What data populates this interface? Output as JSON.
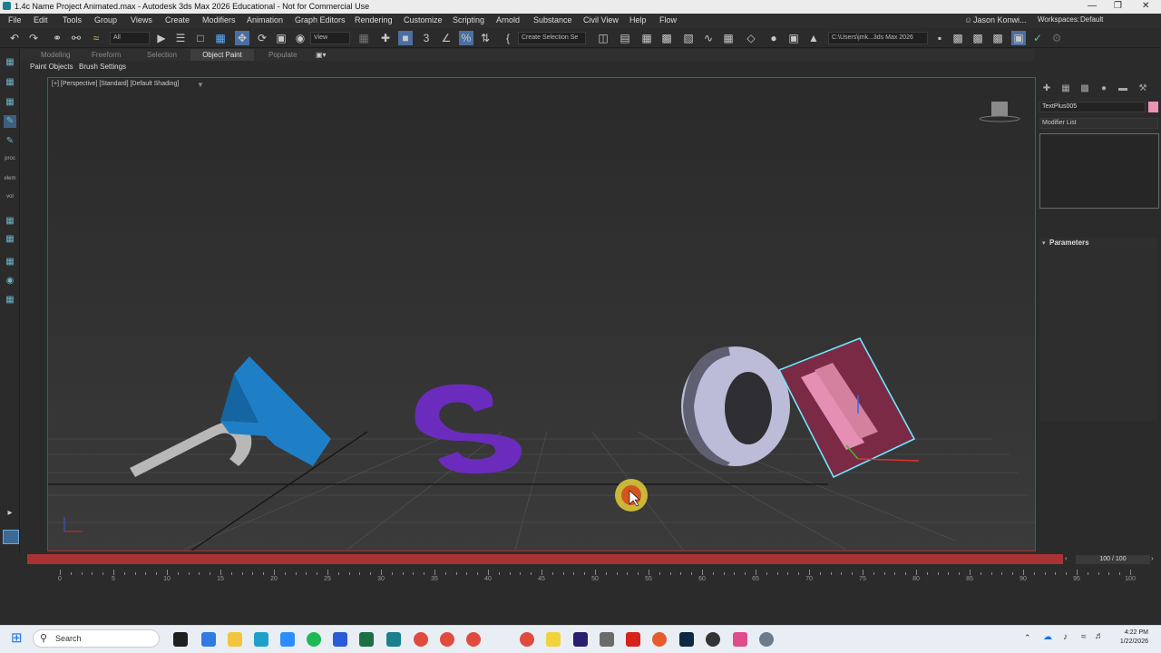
{
  "window": {
    "title": "1.4c Name Project Animated.max - Autodesk 3ds Max 2026 Educational - Not for Commercial Use",
    "minimize": "—",
    "maximize": "❐",
    "close": "✕"
  },
  "menu": [
    "File",
    "Edit",
    "Tools",
    "Group",
    "Views",
    "Create",
    "Modifiers",
    "Animation",
    "Graph Editors",
    "Rendering",
    "Customize",
    "Scripting",
    "Arnold",
    "Substance",
    "Civil View",
    "Help",
    "Flow"
  ],
  "user": {
    "name": "Jason Konwi...",
    "workspaces_label": "Workspaces:",
    "workspace": "Default"
  },
  "toolbar": {
    "filter": "All",
    "refcoord": "View",
    "selection_set": "Create Selection Se",
    "path": "C:\\Users\\jmk...3ds Max 2026"
  },
  "ribbon": {
    "tabs": [
      "Modeling",
      "Freeform",
      "Selection",
      "Object Paint",
      "Populate"
    ],
    "active": "Object Paint",
    "subtabs": [
      "Paint Objects",
      "Brush Settings"
    ]
  },
  "left_tools": [
    "proc",
    "elem",
    "vol"
  ],
  "viewport": {
    "label": "[+] [Perspective] [Standard] [Default Shading]"
  },
  "command_panel": {
    "object_name": "TextPlus005",
    "modifier_list": "Modifier List",
    "rollout": "Parameters",
    "object_color": "#e993b6"
  },
  "timeline": {
    "frame_readout": "100 / 100",
    "ticks": [
      "0",
      "5",
      "10",
      "15",
      "20",
      "25",
      "30",
      "35",
      "40",
      "45",
      "50",
      "55",
      "60",
      "65",
      "70",
      "75",
      "80",
      "85",
      "90",
      "95",
      "100"
    ]
  },
  "taskbar": {
    "search": "Search",
    "time": "4:22 PM",
    "date": "1/22/2026"
  },
  "colors": {
    "accent": "#a93232",
    "selection": "#6fe8ff"
  }
}
